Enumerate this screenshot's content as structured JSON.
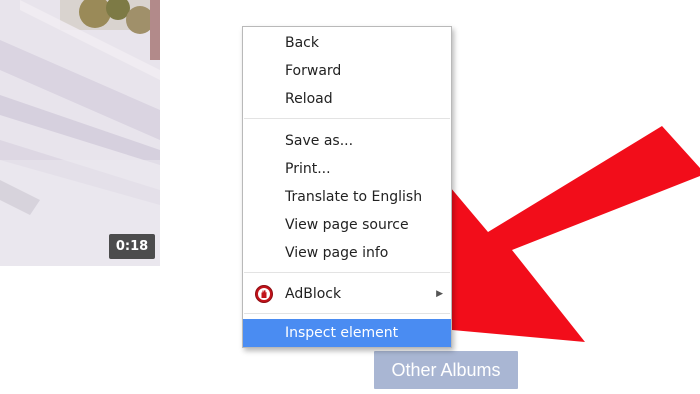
{
  "video": {
    "duration": "0:18"
  },
  "context_menu": {
    "items": [
      {
        "label": "Back"
      },
      {
        "label": "Forward"
      },
      {
        "label": "Reload"
      },
      {
        "label": "Save as..."
      },
      {
        "label": "Print..."
      },
      {
        "label": "Translate to English"
      },
      {
        "label": "View page source"
      },
      {
        "label": "View page info"
      },
      {
        "label": "AdBlock",
        "icon": "adblock-icon",
        "has_submenu": true
      },
      {
        "label": "Inspect element",
        "highlighted": true
      }
    ]
  },
  "albums_button": {
    "label": "Other Albums"
  },
  "colors": {
    "highlight": "#4a8cf2",
    "arrow": "#f20d1a",
    "albums_button": "#a9b6d3",
    "adblock": "#c1131a"
  }
}
